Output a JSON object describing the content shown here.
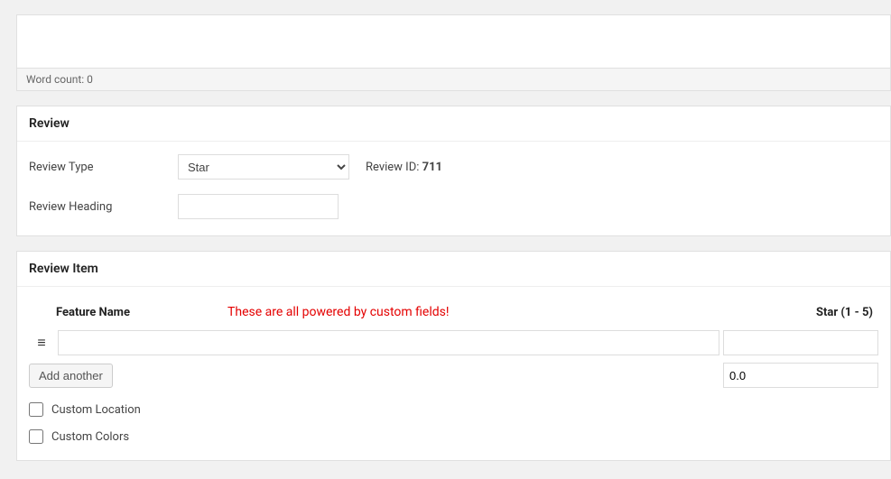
{
  "editor": {
    "word_count_label": "Word count: 0"
  },
  "review": {
    "panel_title": "Review",
    "type_label": "Review Type",
    "type_selected": "Star",
    "id_label": "Review ID:",
    "id_value": "711",
    "heading_label": "Review Heading",
    "heading_value": ""
  },
  "review_item": {
    "panel_title": "Review Item",
    "th_feature": "Feature Name",
    "annotation": "These are all powered by custom fields!",
    "th_star": "Star (1 - 5)",
    "drag_glyph": "≡",
    "feature_value": "",
    "star_value": "",
    "add_button": "Add another",
    "avg_value": "0.0",
    "custom_location_label": "Custom Location",
    "custom_colors_label": "Custom Colors"
  }
}
